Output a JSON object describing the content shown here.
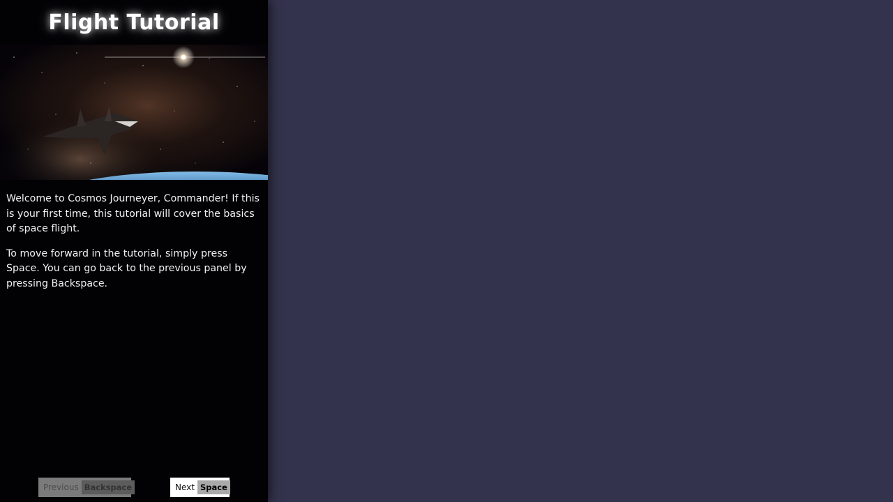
{
  "tutorial": {
    "title": "Flight Tutorial",
    "hero_image": "spaceship-over-planet-milky-way",
    "paragraphs": [
      "Welcome to Cosmos Journeyer, Commander! If this is your first time, this tutorial will cover the basics of space flight.",
      "To move forward in the tutorial, simply press Space. You can go back to the previous panel by pressing Backspace."
    ]
  },
  "navigation": {
    "previous": {
      "label": "Previous",
      "key": "Backspace",
      "enabled": false
    },
    "next": {
      "label": "Next",
      "key": "Space",
      "enabled": true
    }
  },
  "colors": {
    "background": "#34334d",
    "panel": "#020104",
    "planet_rim": "#4fa3e6"
  }
}
